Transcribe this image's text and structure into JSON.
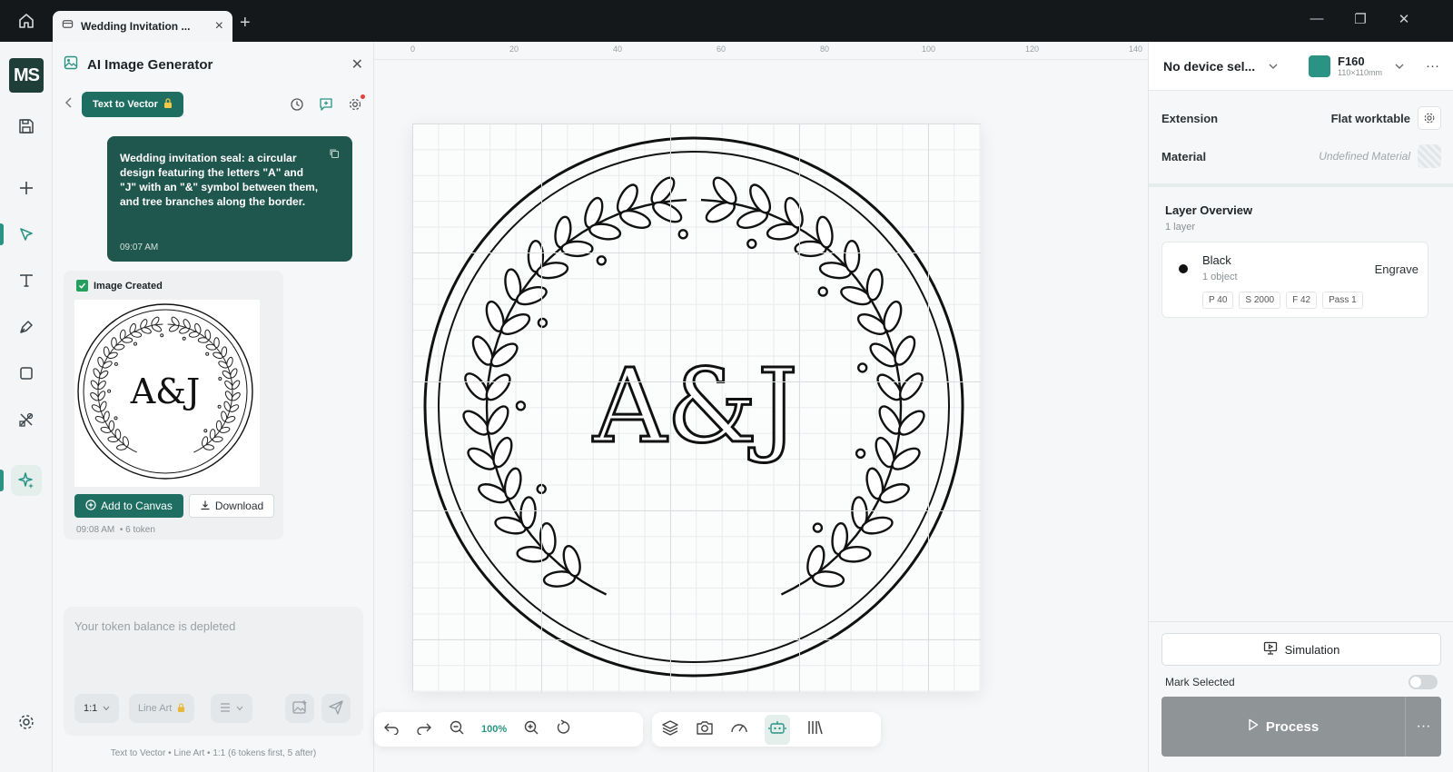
{
  "window": {
    "tab_title": "Wedding Invitation ...",
    "minimize": "—",
    "restore": "❐",
    "close": "✕",
    "tab_add": "+",
    "tab_close": "×"
  },
  "rail": {
    "logo": "MS"
  },
  "panel": {
    "title": "AI Image Generator",
    "mode_pill": "Text to Vector",
    "prompt": "Wedding invitation seal: a circular design featuring the letters \"A\" and \"J\" with an \"&\" symbol between them, and tree branches along the border.",
    "prompt_time": "09:07 AM",
    "result_status": "Image Created",
    "thumbnail_text": "A&J",
    "add_label": "Add to Canvas",
    "download_label": "Download",
    "result_time": "09:08 AM",
    "result_tokens": "• 6 token",
    "composer_placeholder": "Your token balance is depleted",
    "ratio_chip": "1:1",
    "style_chip": "Line Art",
    "footer": "Text to Vector • Line Art • 1:1 (6 tokens first, 5 after)"
  },
  "canvas": {
    "ruler": [
      "0",
      "20",
      "40",
      "60",
      "80",
      "100",
      "120",
      "140"
    ],
    "monogram": "A&J",
    "zoom": "100%"
  },
  "right": {
    "device": "No device sel...",
    "model_name": "F160",
    "model_size": "110×110mm",
    "extension_label": "Extension",
    "extension_value": "Flat worktable",
    "material_label": "Material",
    "material_value": "Undefined Material",
    "layers_title": "Layer Overview",
    "layers_count": "1 layer",
    "layer": {
      "name": "Black",
      "objects": "1 object",
      "mode": "Engrave",
      "params": [
        "P 40",
        "S 2000",
        "F 42",
        "Pass 1"
      ]
    },
    "simulation": "Simulation",
    "mark_selected": "Mark Selected",
    "process": "Process",
    "more": "···"
  },
  "colors": {
    "accent": "#2a9383",
    "dark_green": "#1f564e",
    "titlebar": "#15181b"
  }
}
